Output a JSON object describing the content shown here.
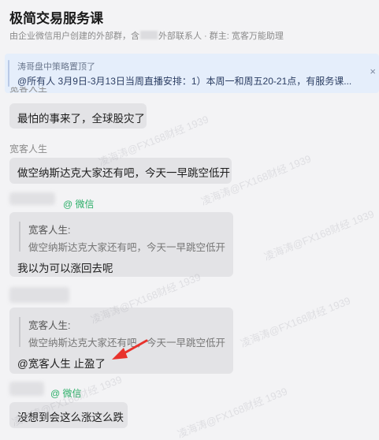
{
  "header": {
    "title": "极简交易服务课",
    "subtitle_prefix": "由企业微信用户创建的外部群，含",
    "subtitle_suffix": "外部联系人 · 群主: 宽客万能助理"
  },
  "pinned": {
    "title": "涛哥盘中策略置顶了",
    "text": "@所有人 3月9日-3月13日当周直播安排：1）本周一和周五20-21点，有服务课...",
    "close_icon": "×"
  },
  "messages": [
    {
      "sender_partial": "宽客人生",
      "text": "最怕的事来了，全球股灾了"
    },
    {
      "sender": "宽客人生",
      "text": "做空纳斯达克大家还有吧，今天一早跳空低开"
    },
    {
      "wechat_tag": "@ 微信",
      "quote_name": "宽客人生:",
      "quote_text": "做空纳斯达克大家还有吧，今天一早跳空低开",
      "text": "我以为可以涨回去呢"
    },
    {
      "quote_name": "宽客人生:",
      "quote_text": "做空纳斯达克大家还有吧，今天一早跳空低开",
      "text": "@宽客人生 止盈了"
    },
    {
      "wechat_tag": "@ 微信",
      "text": "没想到会这么涨这么跌"
    }
  ],
  "watermark_text": "凌海涛@FX168财经 1939",
  "colors": {
    "arrow": "#e8322c",
    "wechat_green": "#2aae67",
    "pinned_bg": "#e5eefb"
  }
}
